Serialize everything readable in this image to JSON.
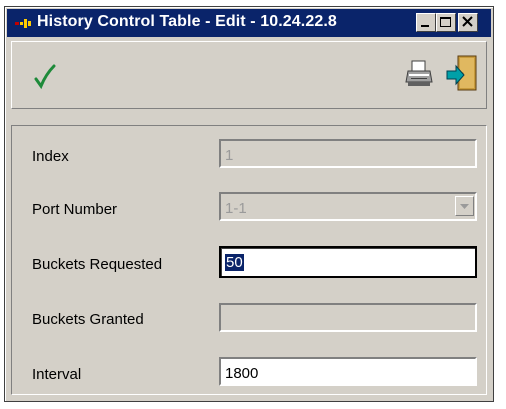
{
  "window": {
    "title": "History Control Table -  Edit - 10.24.22.8"
  },
  "titlebar_buttons": [
    {
      "name": "minimize-icon"
    },
    {
      "name": "maximize-icon"
    },
    {
      "name": "close-icon"
    }
  ],
  "toolbar": {
    "apply_icon": "checkmark-icon",
    "print_icon": "printer-icon",
    "exit_icon": "exit-door-icon",
    "checkmark_color": "#1e8a3a"
  },
  "form": {
    "index": {
      "label": "Index",
      "value": "1"
    },
    "port_number": {
      "label": "Port Number",
      "value": "1-1"
    },
    "buckets_requested": {
      "label": "Buckets Requested",
      "value": "50"
    },
    "buckets_granted": {
      "label": "Buckets Granted",
      "value": ""
    },
    "interval": {
      "label": "Interval",
      "value": "1800"
    }
  }
}
